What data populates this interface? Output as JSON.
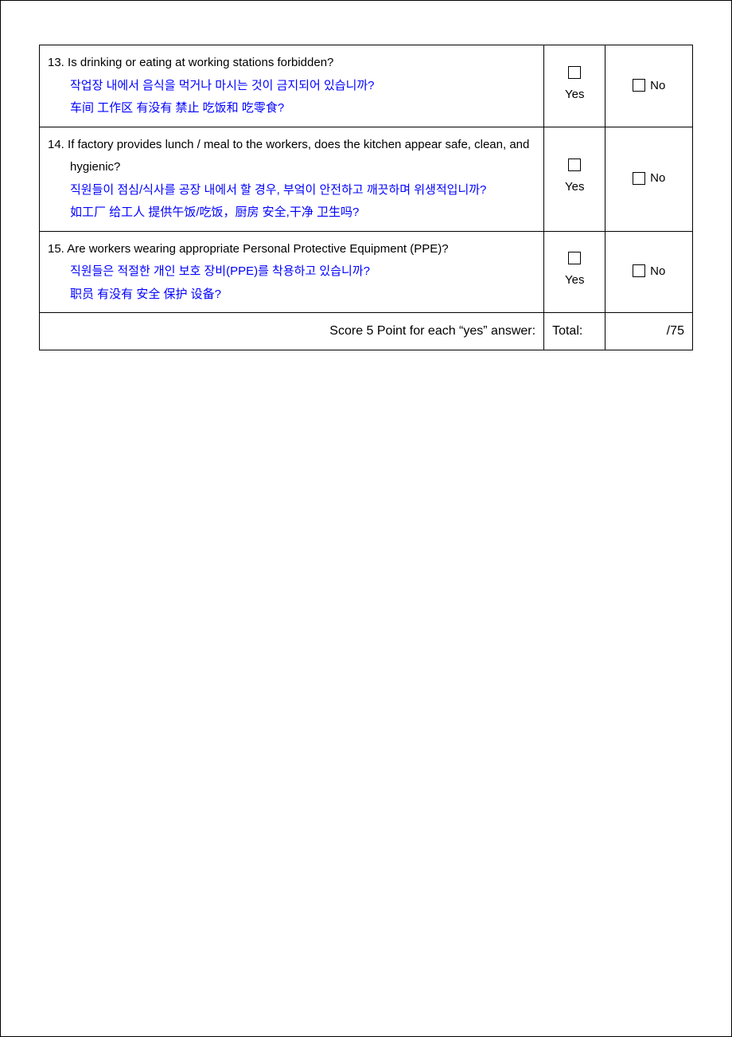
{
  "labels": {
    "yes": "Yes",
    "no": "No"
  },
  "questions": [
    {
      "num": "13.",
      "en": "Is drinking or eating at working stations forbidden?",
      "ko": "작업장 내에서 음식을 먹거나 마시는 것이 금지되어 있습니까?",
      "zh": "车间 工作区 有没有 禁止 吃饭和 吃零食?"
    },
    {
      "num": "14.",
      "en": "If factory provides lunch / meal to the workers, does the kitchen appear safe, clean, and hygienic?",
      "ko": "직원들이 점심/식사를 공장 내에서 할 경우, 부엌이 안전하고 깨끗하며 위생적입니까?",
      "zh": "如工厂 给工人 提供午饭/吃饭，厨房 安全,干净 卫生吗?"
    },
    {
      "num": "15.",
      "en": "Are workers wearing appropriate Personal Protective Equipment (PPE)?",
      "ko": "직원들은 적절한 개인 보호 장비(PPE)를 착용하고 있습니까?",
      "zh": "职员 有没有 安全 保护 设备?"
    }
  ],
  "footer": {
    "label": "Score 5 Point for each “yes” answer:",
    "total_label": "Total:",
    "score": "/75"
  }
}
